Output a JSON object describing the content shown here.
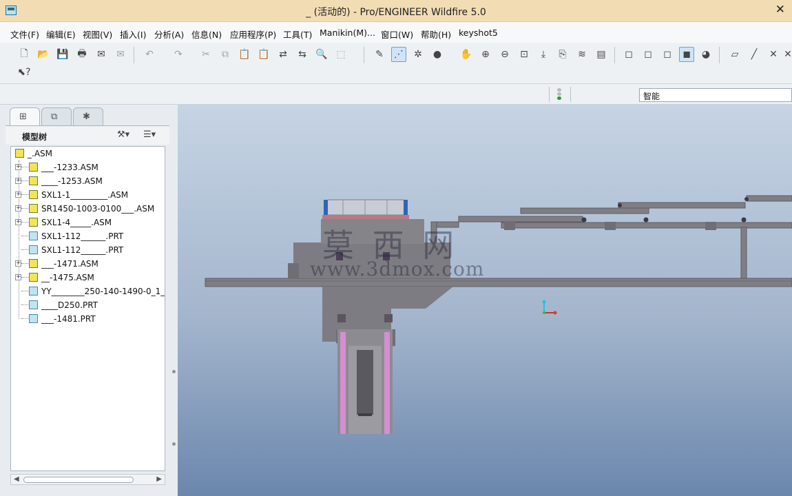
{
  "window": {
    "title": "_ (活动的) - Pro/ENGINEER Wildfire 5.0",
    "close_glyph": "✕"
  },
  "menu": {
    "items": [
      "文件(F)",
      "编辑(E)",
      "视图(V)",
      "插入(I)",
      "分析(A)",
      "信息(N)",
      "应用程序(P)",
      "工具(T)",
      "Manikin(M)...",
      "窗口(W)",
      "帮助(H)",
      "keyshot5"
    ]
  },
  "filter": {
    "value": "智能"
  },
  "model_tree": {
    "header": "模型树",
    "rows": [
      {
        "label": "_.ASM",
        "type": "asm",
        "expandable": false,
        "root": true
      },
      {
        "label": "___-1233.ASM",
        "type": "asm",
        "expandable": true
      },
      {
        "label": "____-1253.ASM",
        "type": "asm",
        "expandable": true
      },
      {
        "label": "SXL1-1_________.ASM",
        "type": "asm",
        "expandable": true
      },
      {
        "label": "SR1450-1003-0100___.ASM",
        "type": "asm",
        "expandable": true
      },
      {
        "label": "SXL1-4_____.ASM",
        "type": "asm",
        "expandable": true
      },
      {
        "label": "SXL1-112______.PRT",
        "type": "prt",
        "expandable": false
      },
      {
        "label": "SXL1-112______.PRT",
        "type": "prt",
        "expandable": false
      },
      {
        "label": "___-1471.ASM",
        "type": "asm",
        "expandable": true
      },
      {
        "label": "__-1475.ASM",
        "type": "asm",
        "expandable": true
      },
      {
        "label": "YY________250-140-1490-0_1_",
        "type": "prt",
        "expandable": false
      },
      {
        "label": "____D250.PRT",
        "type": "prt",
        "expandable": false
      },
      {
        "label": "___-1481.PRT",
        "type": "prt",
        "expandable": false
      }
    ]
  },
  "watermark": {
    "cn": "莫 西 网",
    "url": "www.3dmox.com"
  },
  "colors": {
    "viewport_top": "#c6d4e4",
    "viewport_bottom": "#6b87ad",
    "model_gray": "#7d7c82",
    "accent_pink": "#d58fd0"
  }
}
